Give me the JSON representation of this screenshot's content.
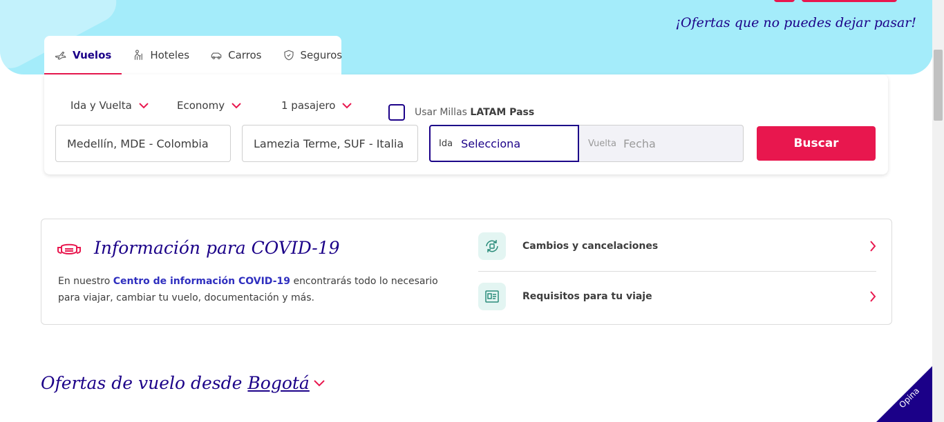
{
  "hero": {
    "tagline": "¡Ofertas que no puedes dejar pasar!"
  },
  "tabs": [
    {
      "label": "Vuelos",
      "icon": "plane-icon",
      "active": true
    },
    {
      "label": "Hoteles",
      "icon": "bellhop-icon",
      "active": false
    },
    {
      "label": "Carros",
      "icon": "car-icon",
      "active": false
    },
    {
      "label": "Seguros",
      "icon": "shield-icon",
      "active": false
    }
  ],
  "search": {
    "trip_type": "Ida y Vuelta",
    "cabin": "Economy",
    "passengers": "1 pasajero",
    "miles_label": "Usar Millas",
    "miles_brand": "LATAM Pass",
    "origin": "Medellín, MDE - Colombia",
    "destination": "Lamezia Terme, SUF - Italia",
    "ida_label": "Ida",
    "ida_value": "Selecciona",
    "vuelta_label": "Vuelta",
    "vuelta_value": "Fecha",
    "submit_label": "Buscar"
  },
  "covid": {
    "title": "Información para COVID-19",
    "text_before": "En nuestro ",
    "link": "Centro de información COVID-19",
    "text_after": " encontrarás todo lo necesario para viajar, cambiar tu vuelo, documentación y más.",
    "links": [
      {
        "label": "Cambios y cancelaciones",
        "icon": "calendar-refresh-icon"
      },
      {
        "label": "Requisitos para tu viaje",
        "icon": "document-id-icon"
      }
    ]
  },
  "offers": {
    "prefix": "Ofertas de vuelo desde",
    "city": "Bogotá"
  },
  "feedback": {
    "label": "Opina"
  },
  "colors": {
    "brand_indigo": "#1b0088",
    "brand_pink": "#e8174e",
    "hero_cyan": "#a4ecfa"
  }
}
